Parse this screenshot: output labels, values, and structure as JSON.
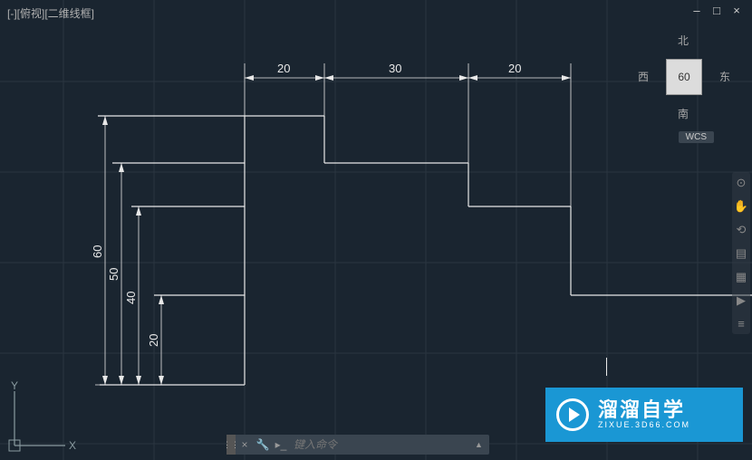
{
  "viewport": {
    "label": "[-][俯视][二维线框]"
  },
  "window_controls": {
    "minimize": "–",
    "maximize": "□",
    "close": "×"
  },
  "dimensions": {
    "h1": "20",
    "h2": "30",
    "h3": "20",
    "v1": "60",
    "v2": "50",
    "v3": "40",
    "v4": "20"
  },
  "ucs": {
    "x": "X",
    "y": "Y"
  },
  "viewcube": {
    "top": "北",
    "bottom": "南",
    "left": "西",
    "right": "东",
    "face": "60"
  },
  "wcs": "WCS",
  "command": {
    "placeholder": "键入命令",
    "close": "×",
    "wrench": "🔧",
    "prompt": "⌨"
  },
  "watermark": {
    "title": "溜溜自学",
    "sub": "ZIXUE.3D66.COM"
  }
}
